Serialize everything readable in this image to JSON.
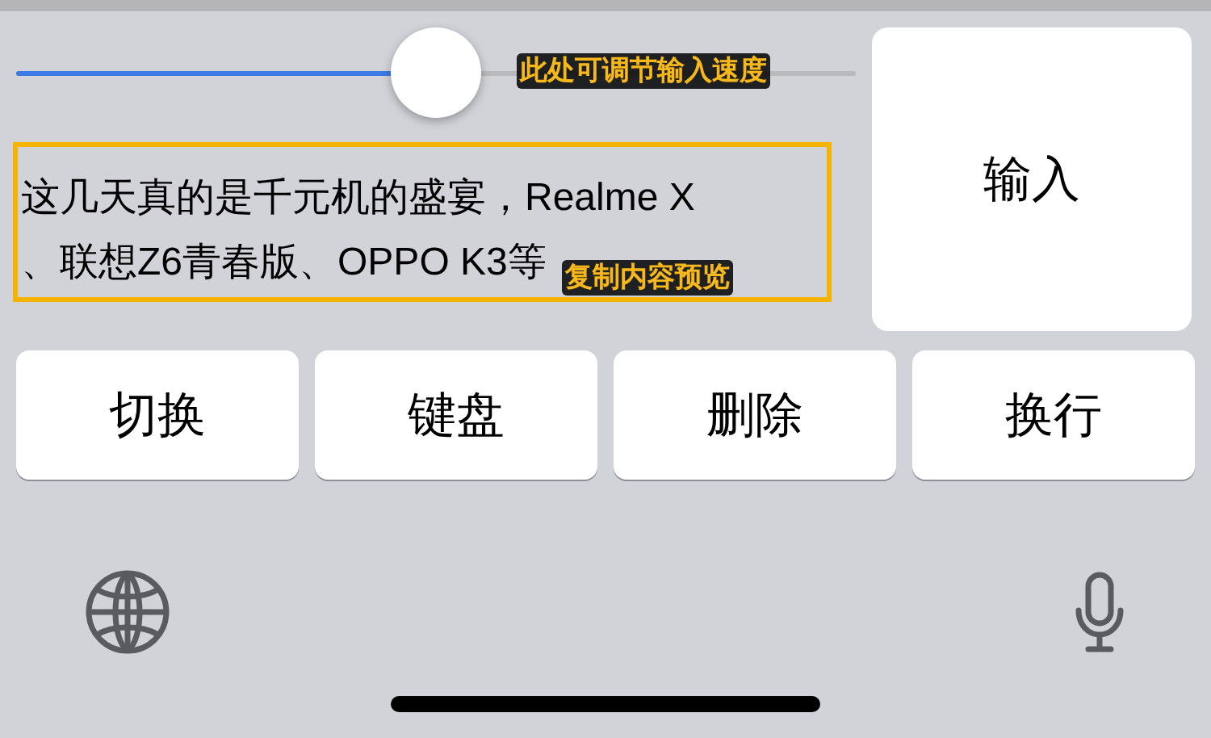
{
  "speed_slider": {
    "level": 0.5,
    "annotation": "此处可调节输入速度"
  },
  "preview": {
    "lines": [
      "这几天真的是千元机的盛宴，Realme X",
      "、联想Z6青春版、OPPO K3等"
    ],
    "annotation": "复制内容预览"
  },
  "input_button": "输入",
  "keys": [
    "切换",
    "键盘",
    "删除",
    "换行"
  ]
}
